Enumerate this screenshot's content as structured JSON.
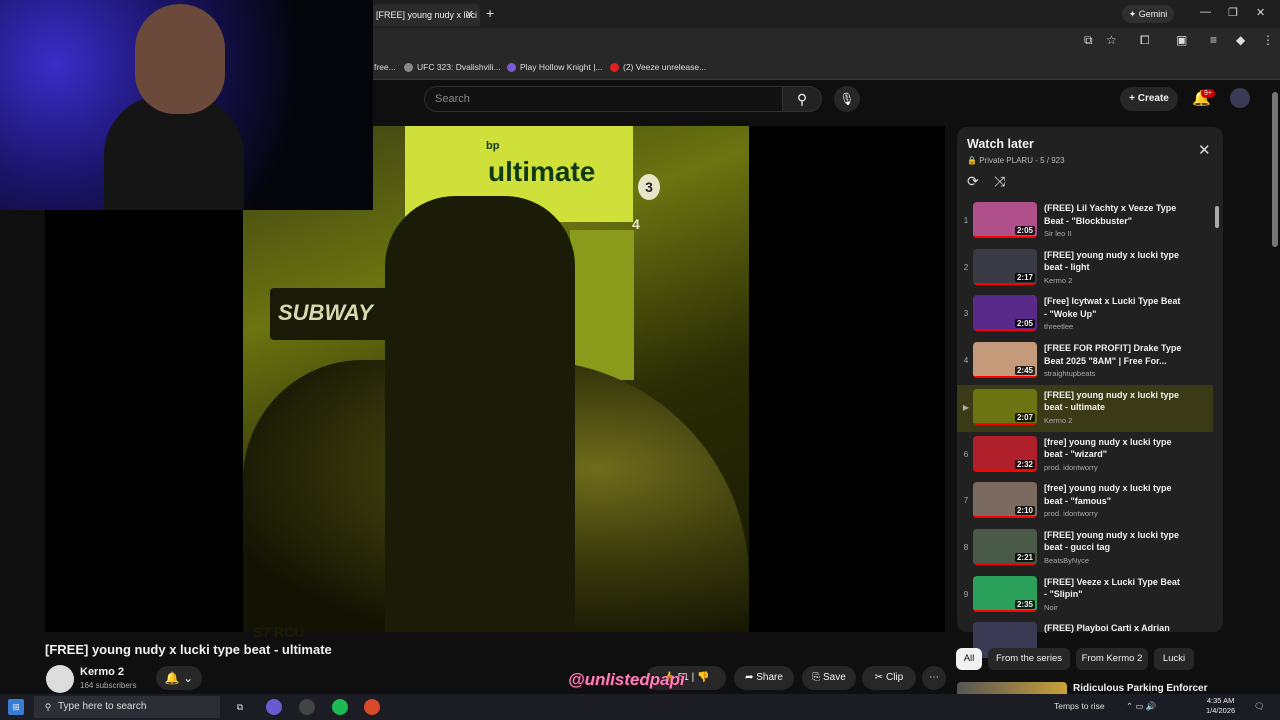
{
  "browser": {
    "active_tab_title": "[FREE] young nudy x luci",
    "gemini_label": "Gemini",
    "bookmarks": [
      "free...",
      "UFC 323: Dvalishvili...",
      "Play Hollow Knight |...",
      "(2) Veeze unrelease..."
    ]
  },
  "youtube": {
    "search_placeholder": "Search",
    "create_label": "Create",
    "notification_badge": "9+"
  },
  "video": {
    "title": "[FREE] young nudy x lucki type beat - ultimate",
    "thumbnail_sign_brand": "bp",
    "thumbnail_sign_text": "ultimate",
    "thumbnail_store_text": "SUBWAY",
    "thumbnail_pump_3": "3",
    "thumbnail_pump_4": "4",
    "thumbnail_plate": "S7 RCU",
    "channel": "Kermo 2",
    "subscribers": "164 subscribers",
    "likes": "51",
    "share_label": "Share",
    "save_label": "Save",
    "clip_label": "Clip"
  },
  "watermark": "@unlistedpapi",
  "watch_later": {
    "title": "Watch later",
    "subtitle": "Private PLARU - 5 / 923",
    "items": [
      {
        "index": "1",
        "title": "(FREE) Lil Yachty x Veeze Type Beat - \"Blockbuster\"",
        "channel": "Sir leo II",
        "duration": "2:05",
        "color": "#b0508a"
      },
      {
        "index": "2",
        "title": "[FREE] young nudy x lucki type beat - light",
        "channel": "Kermo 2",
        "duration": "2:17",
        "color": "#3a3a44"
      },
      {
        "index": "3",
        "title": "[Free] Icytwat x Lucki Type Beat - \"Woke Up\"",
        "channel": "threetlee",
        "duration": "2:05",
        "color": "#5a2a8a"
      },
      {
        "index": "4",
        "title": "[FREE FOR PROFIT] Drake Type Beat 2025 \"8AM\" | Free For...",
        "channel": "straightupbeats",
        "duration": "2:45",
        "color": "#c59a7a"
      },
      {
        "index": "▶",
        "title": "[FREE] young nudy x lucki type beat - ultimate",
        "channel": "Kermo 2",
        "duration": "2:07",
        "color": "#6b7410"
      },
      {
        "index": "6",
        "title": "[free] young nudy x lucki type beat - \"wizard\"",
        "channel": "prod. idontworry",
        "duration": "2:32",
        "color": "#b0202a"
      },
      {
        "index": "7",
        "title": "[free] young nudy x lucki type beat - \"famous\"",
        "channel": "prod. idontworry",
        "duration": "2:10",
        "color": "#7a6a60"
      },
      {
        "index": "8",
        "title": "[FREE] young nudy x lucki type beat - gucci tag",
        "channel": "BeatsByNyce",
        "duration": "2:21",
        "color": "#4a5a48"
      },
      {
        "index": "9",
        "title": "[FREE] Veeze x Lucki Type Beat - \"Slipin\"",
        "channel": "Noir",
        "duration": "2:35",
        "color": "#2aa05a"
      },
      {
        "index": "",
        "title": "(FREE) Playboi Carti x Adrian",
        "channel": "",
        "duration": "",
        "color": "#3a3a55"
      }
    ]
  },
  "chips": [
    "All",
    "From the series",
    "From Kermo 2",
    "Lucki"
  ],
  "recommendation_title": "Ridiculous Parking Enforcer",
  "taskbar": {
    "search_placeholder": "Type here to search",
    "weather": "Temps to rise",
    "time": "4:35 AM",
    "date": "1/4/2026"
  }
}
